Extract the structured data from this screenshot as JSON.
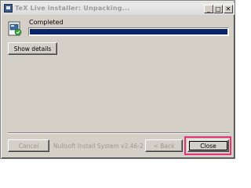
{
  "window": {
    "title": "TeX Live installer: Unpacking...",
    "controls": {
      "minimize": "_",
      "maximize": "□",
      "close": "✕"
    }
  },
  "status": {
    "label": "Completed",
    "progress_fraction": 1.0
  },
  "buttons": {
    "show_details": "Show details",
    "cancel": "Cancel",
    "back": "< Back",
    "close": "Close"
  },
  "footer": {
    "brand": "Nullsoft Install System v2.46-2"
  },
  "colors": {
    "progress_fill": "#0a246a",
    "highlight": "#e0337a"
  }
}
